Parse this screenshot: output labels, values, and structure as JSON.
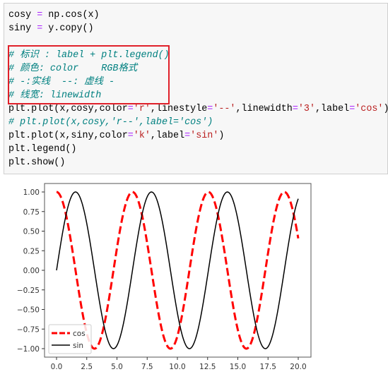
{
  "code_lines": [
    [
      [
        "t",
        "cosy "
      ],
      [
        "op",
        "="
      ],
      [
        "t",
        " np.cos(x)"
      ]
    ],
    [
      [
        "t",
        "siny "
      ],
      [
        "op",
        "="
      ],
      [
        "t",
        " y.copy()"
      ]
    ],
    [],
    [
      [
        "cm",
        "# 标识 : label + plt.legend()"
      ]
    ],
    [
      [
        "cm",
        "# 颜色: color    RGB格式"
      ]
    ],
    [
      [
        "cm",
        "# -:实线  --: 虚线 -"
      ]
    ],
    [
      [
        "cm",
        "# 线宽: linewidth"
      ]
    ],
    [
      [
        "t",
        "plt.plot(x,cosy,color"
      ],
      [
        "op",
        "="
      ],
      [
        "str",
        "'r'"
      ],
      [
        "t",
        ",linestyle"
      ],
      [
        "op",
        "="
      ],
      [
        "str",
        "'--'"
      ],
      [
        "t",
        ",linewidth"
      ],
      [
        "op",
        "="
      ],
      [
        "str",
        "'3'"
      ],
      [
        "t",
        ",label"
      ],
      [
        "op",
        "="
      ],
      [
        "str",
        "'cos'"
      ],
      [
        "t",
        ")"
      ]
    ],
    [
      [
        "cm",
        "# plt.plot(x,cosy,'r--',label='cos')"
      ]
    ],
    [
      [
        "t",
        "plt.plot(x,siny,color"
      ],
      [
        "op",
        "="
      ],
      [
        "str",
        "'k'"
      ],
      [
        "t",
        ",label"
      ],
      [
        "op",
        "="
      ],
      [
        "str",
        "'sin'"
      ],
      [
        "t",
        ")"
      ]
    ],
    [
      [
        "t",
        "plt.legend()"
      ]
    ],
    [
      [
        "t",
        "plt.show()"
      ]
    ]
  ],
  "highlight_color": "#e0202a",
  "chart_data": {
    "type": "line",
    "xlim": [
      -1,
      21
    ],
    "ylim": [
      -1.1,
      1.1
    ],
    "x_range": [
      0,
      20
    ],
    "xticks": [
      "0.0",
      "2.5",
      "5.0",
      "7.5",
      "10.0",
      "12.5",
      "15.0",
      "17.5",
      "20.0"
    ],
    "xtick_values": [
      0,
      2.5,
      5,
      7.5,
      10,
      12.5,
      15,
      17.5,
      20
    ],
    "yticks": [
      "1.00",
      "0.75",
      "0.50",
      "0.25",
      "0.00",
      "−0.25",
      "−0.50",
      "−0.75",
      "−1.00"
    ],
    "ytick_values": [
      1,
      0.75,
      0.5,
      0.25,
      0,
      -0.25,
      -0.5,
      -0.75,
      -1
    ],
    "grid": false,
    "legend_placement": "lower-left",
    "series": [
      {
        "name": "cos",
        "expression": "cos(x)",
        "color": "#ff0000",
        "linestyle": "dashed",
        "linewidth": 3
      },
      {
        "name": "sin",
        "expression": "sin(x)",
        "color": "#000000",
        "linestyle": "solid",
        "linewidth": 1.5
      }
    ]
  }
}
